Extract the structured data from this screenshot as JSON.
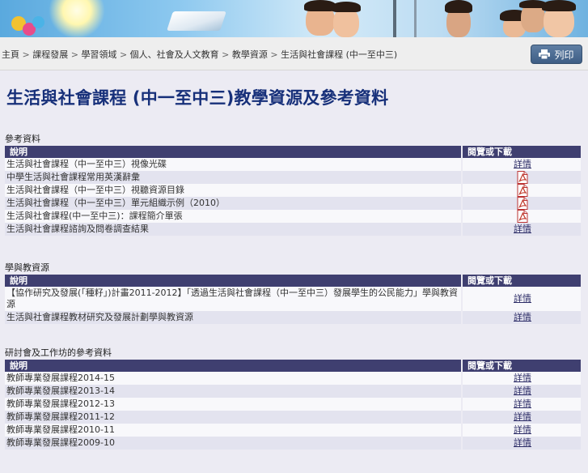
{
  "breadcrumb": [
    "主頁",
    "課程發展",
    "學習領域",
    "個人、社會及人文教育",
    "教學資源",
    "生活與社會課程 (中一至中三)"
  ],
  "breadcrumb_sep": ">",
  "print_label": "列印",
  "page_title": "生活與社會課程 (中一至中三)教學資源及參考資料",
  "sections": [
    {
      "title": "參考資料",
      "col_desc": "說明",
      "col_action": "閱覽或下載",
      "rows": [
        {
          "desc": "生活與社會課程（中一至中三）視像光碟",
          "action": "詳情",
          "type": "link"
        },
        {
          "desc": "中學生活與社會課程常用英漢辭彙",
          "action": "",
          "type": "pdf"
        },
        {
          "desc": "生活與社會課程（中一至中三）視聽資源目錄",
          "action": "",
          "type": "pdf"
        },
        {
          "desc": "生活與社會課程（中一至中三）單元組織示例（2010）",
          "action": "",
          "type": "pdf"
        },
        {
          "desc": "生活與社會課程(中一至中三)：課程簡介單張",
          "action": "",
          "type": "pdf"
        },
        {
          "desc": "生活與社會課程諮詢及問卷調查結果",
          "action": "詳情",
          "type": "link"
        }
      ]
    },
    {
      "title": "學與教資源",
      "col_desc": "說明",
      "col_action": "閱覽或下載",
      "rows": [
        {
          "desc": "【協作研究及發展(「種籽」)計畫2011-2012】「透過生活與社會課程（中一至中三）發展學生的公民能力」學與教資源",
          "action": "詳情",
          "type": "link"
        },
        {
          "desc": "生活與社會課程教材研究及發展計劃學與教資源",
          "action": "詳情",
          "type": "link"
        }
      ]
    },
    {
      "title": "研討會及工作坊的參考資料",
      "col_desc": "說明",
      "col_action": "閱覽或下載",
      "rows": [
        {
          "desc": "教師專業發展課程2014-15",
          "action": "詳情",
          "type": "link"
        },
        {
          "desc": "教師專業發展課程2013-14",
          "action": "詳情",
          "type": "link"
        },
        {
          "desc": "教師專業發展課程2012-13",
          "action": "詳情",
          "type": "link"
        },
        {
          "desc": "教師專業發展課程2011-12",
          "action": "詳情",
          "type": "link"
        },
        {
          "desc": "教師專業發展課程2010-11",
          "action": "詳情",
          "type": "link"
        },
        {
          "desc": "教師專業發展課程2009-10",
          "action": "詳情",
          "type": "link"
        }
      ]
    }
  ],
  "icons": {
    "print": "printer-icon",
    "pdf": "pdf-file-icon"
  },
  "colors": {
    "header_bg": "#3f3f70",
    "title": "#17307a",
    "print_btn": "#4a6a92",
    "pdf": "#c0392b"
  }
}
